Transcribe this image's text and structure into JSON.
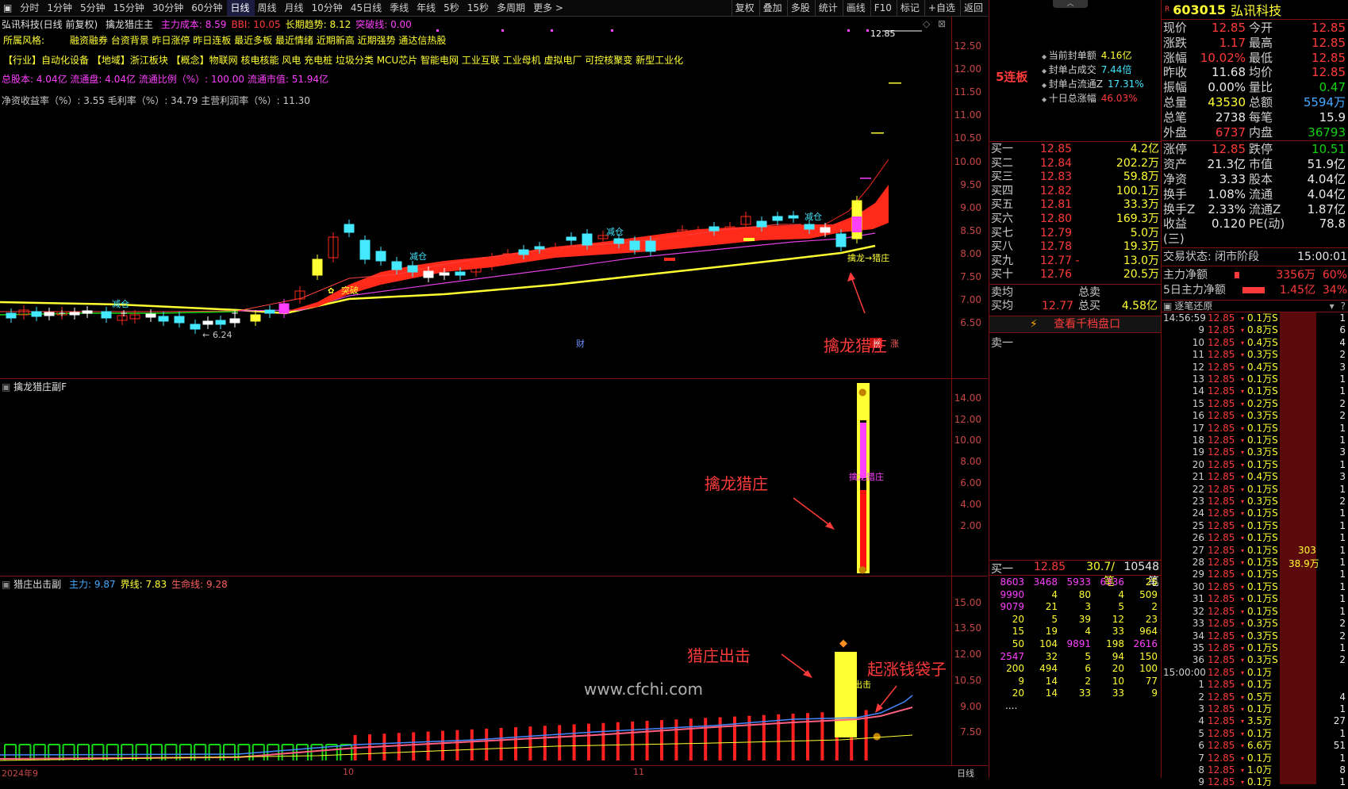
{
  "toolbar": {
    "periods": [
      "分时",
      "1分钟",
      "5分钟",
      "15分钟",
      "30分钟",
      "60分钟",
      "日线",
      "周线",
      "月线",
      "10分钟",
      "45日线",
      "季线",
      "年线",
      "5秒",
      "15秒",
      "多周期",
      "更多 >"
    ],
    "active": "日线",
    "right": [
      "复权",
      "叠加",
      "多股",
      "统计",
      "画线",
      "F10",
      "标记",
      "+自选",
      "返回"
    ]
  },
  "main_chart": {
    "title": "弘讯科技(日线 前复权)",
    "indicator": "擒龙猎庄主",
    "line1": [
      {
        "t": "主力成本: 8.59",
        "c": "#ff40ff"
      },
      {
        "t": "BBI: 10.05",
        "c": "#ff3a3a"
      },
      {
        "t": "长期趋势: 8.12",
        "c": "#ffff33"
      },
      {
        "t": "突破线: 0.00",
        "c": "#ff40ff"
      }
    ],
    "style_label": "所属风格:",
    "styles": "融资融券 台资背景 昨日涨停 昨日连板 最近多板 最近情绪 近期新高 近期强势 通达信热股",
    "concepts": "【行业】自动化设备 【地域】浙江板块 【概念】物联网 核电核能 风电 充电桩 垃圾分类 MCU芯片 智能电网 工业互联 工业母机 虚拟电厂 可控核聚变 新型工业化",
    "capital": "总股本: 4.04亿 流通盘: 4.04亿 流通比例（%）: 100.00 流通市值: 51.94亿",
    "ratios": "净资收益率（%）: 3.55 毛利率（%）: 34.79 主营利润率（%）: 11.30",
    "yaxis": [
      "12.50",
      "12.00",
      "11.50",
      "11.00",
      "10.50",
      "10.00",
      "9.50",
      "9.00",
      "8.50",
      "8.00",
      "7.50",
      "7.00",
      "6.50"
    ],
    "price_tag": "12.85",
    "low_tag": "6.24",
    "labels": {
      "reduce": "减仓",
      "breakout": "突破",
      "qinlong": "擒龙",
      "liezhuang": "猎庄",
      "cai": "财",
      "bang": "榜",
      "zhang": "涨"
    },
    "annotation": "擒龙猎庄"
  },
  "sub1": {
    "title": "擒龙猎庄副F",
    "yaxis": [
      "14.00",
      "12.00",
      "10.00",
      "8.00",
      "6.00",
      "4.00",
      "2.00"
    ],
    "annotation": "擒龙猎庄",
    "bar_label": "擒龙猎庄"
  },
  "sub2": {
    "title": "猎庄出击副",
    "values": [
      {
        "t": "主力: 9.87",
        "c": "#44aaff"
      },
      {
        "t": "界线: 7.83",
        "c": "#ffff33"
      },
      {
        "t": "生命线: 9.28",
        "c": "#ff6060"
      }
    ],
    "yaxis": [
      "15.00",
      "13.50",
      "12.00",
      "10.50",
      "9.00",
      "7.50"
    ],
    "annotation1": "猎庄出击",
    "annotation2": "起涨钱袋子",
    "bar_label": "猎庄出击",
    "watermark": "www.cfchi.com"
  },
  "xaxis": {
    "labels": [
      "2024年9",
      "10",
      "11"
    ],
    "right": "日线"
  },
  "middle": {
    "lianban": "5连板",
    "stats": [
      {
        "k": "当前封单额",
        "v": "4.16亿",
        "c": "#ffff33"
      },
      {
        "k": "封单占成交",
        "v": "7.44倍",
        "c": "#44e8ff"
      },
      {
        "k": "封单占流通Z",
        "v": "17.31%",
        "c": "#44e8ff"
      },
      {
        "k": "十日总涨幅",
        "v": "46.03%",
        "c": "#ff3a3a"
      }
    ],
    "buys": [
      [
        "买一",
        "12.85",
        "4.2亿"
      ],
      [
        "买二",
        "12.84",
        "202.2万"
      ],
      [
        "买三",
        "12.83",
        "59.8万"
      ],
      [
        "买四",
        "12.82",
        "100.1万"
      ],
      [
        "买五",
        "12.81",
        "33.3万"
      ],
      [
        "买六",
        "12.80",
        "169.3万"
      ],
      [
        "买七",
        "12.79",
        "5.0万"
      ],
      [
        "买八",
        "12.78",
        "19.3万"
      ],
      [
        "买九",
        "12.77 -",
        "13.0万"
      ],
      [
        "买十",
        "12.76",
        "20.5万"
      ]
    ],
    "sell_avg": "卖均",
    "sell_total": "总卖",
    "buy_avg": "买均",
    "buy_avg_val": "12.77",
    "buy_total": "总买",
    "buy_total_val": "4.58亿",
    "view_qian": "查看千档盘口",
    "sell1": "卖一",
    "queue_head": [
      "买一",
      "12.85",
      "30.7/笔",
      "10548笔"
    ],
    "queue": [
      [
        "8603",
        "3468",
        "5933",
        "6336",
        "25"
      ],
      [
        "9990",
        "4",
        "80",
        "4",
        "509"
      ],
      [
        "9079",
        "21",
        "3",
        "5",
        "2"
      ],
      [
        "20",
        "5",
        "39",
        "12",
        "23"
      ],
      [
        "15",
        "19",
        "4",
        "33",
        "964"
      ],
      [
        "50",
        "104",
        "9891",
        "198",
        "2616"
      ],
      [
        "2547",
        "32",
        "5",
        "94",
        "150"
      ],
      [
        "200",
        "494",
        "6",
        "20",
        "100"
      ],
      [
        "9",
        "14",
        "2",
        "10",
        "77"
      ],
      [
        "20",
        "14",
        "33",
        "33",
        "9"
      ]
    ],
    "queue_more": "...."
  },
  "quote": {
    "code": "603015",
    "name": "弘讯科技",
    "rows": [
      [
        "现价",
        "12.85",
        "今开",
        "12.85"
      ],
      [
        "涨跌",
        "1.17",
        "最高",
        "12.85"
      ],
      [
        "涨幅",
        "10.02%",
        "最低",
        "12.85"
      ],
      [
        "昨收",
        "11.68",
        "均价",
        "12.85"
      ],
      [
        "振幅",
        "0.00%",
        "量比",
        "0.47"
      ],
      [
        "总量",
        "43530",
        "总额",
        "5594万"
      ],
      [
        "总笔",
        "2738",
        "每笔",
        "15.9"
      ],
      [
        "外盘",
        "6737",
        "内盘",
        "36793"
      ]
    ],
    "rows2": [
      [
        "涨停",
        "12.85",
        "跌停",
        "10.51"
      ],
      [
        "资产",
        "21.3亿",
        "市值",
        "51.9亿"
      ],
      [
        "净资",
        "3.33",
        "股本",
        "4.04亿"
      ],
      [
        "换手",
        "1.08%",
        "流通",
        "4.04亿"
      ],
      [
        "换手Z",
        "2.33%",
        "流通Z",
        "1.87亿"
      ],
      [
        "收益(三)",
        "0.120",
        "PE(动)",
        "78.8"
      ]
    ],
    "trade_state": "交易状态: 闭市阶段",
    "trade_time": "15:00:01",
    "main_net_label": "主力净额",
    "main_net_val": "3356万",
    "main_net_pct": "60%",
    "five_net_label": "5日主力净额",
    "five_net_val": "1.45亿",
    "five_net_pct": "34%",
    "tick_title": "逐笔还原",
    "ticks": [
      [
        "14:56:59",
        "12.85",
        "0.1万S",
        "1"
      ],
      [
        "9",
        "12.85",
        "0.8万S",
        "6"
      ],
      [
        "10",
        "12.85",
        "0.4万S",
        "4"
      ],
      [
        "11",
        "12.85",
        "0.3万S",
        "2"
      ],
      [
        "12",
        "12.85",
        "0.4万S",
        "3"
      ],
      [
        "13",
        "12.85",
        "0.1万S",
        "1"
      ],
      [
        "14",
        "12.85",
        "0.1万S",
        "1"
      ],
      [
        "15",
        "12.85",
        "0.2万S",
        "2"
      ],
      [
        "16",
        "12.85",
        "0.3万S",
        "2"
      ],
      [
        "17",
        "12.85",
        "0.1万S",
        "1"
      ],
      [
        "18",
        "12.85",
        "0.1万S",
        "1"
      ],
      [
        "19",
        "12.85",
        "0.3万S",
        "3"
      ],
      [
        "20",
        "12.85",
        "0.1万S",
        "1"
      ],
      [
        "21",
        "12.85",
        "0.4万S",
        "3"
      ],
      [
        "22",
        "12.85",
        "0.1万S",
        "1"
      ],
      [
        "23",
        "12.85",
        "0.3万S",
        "2"
      ],
      [
        "24",
        "12.85",
        "0.1万S",
        "1"
      ],
      [
        "25",
        "12.85",
        "0.1万S",
        "1"
      ],
      [
        "26",
        "12.85",
        "0.1万S",
        "1"
      ],
      [
        "27",
        "12.85",
        "0.1万S",
        "1"
      ],
      [
        "28",
        "12.85",
        "0.1万S",
        "1"
      ],
      [
        "29",
        "12.85",
        "0.1万S",
        "1"
      ],
      [
        "30",
        "12.85",
        "0.1万S",
        "1"
      ],
      [
        "31",
        "12.85",
        "0.1万S",
        "1"
      ],
      [
        "32",
        "12.85",
        "0.1万S",
        "1"
      ],
      [
        "33",
        "12.85",
        "0.3万S",
        "2"
      ],
      [
        "34",
        "12.85",
        "0.3万S",
        "2"
      ],
      [
        "35",
        "12.85",
        "0.1万S",
        "1"
      ],
      [
        "36",
        "12.85",
        "0.3万S",
        "2"
      ],
      [
        "15:00:00",
        "12.85",
        "0.1万",
        ""
      ],
      [
        "1",
        "12.85",
        "0.1万",
        ""
      ],
      [
        "2",
        "12.85",
        "0.5万",
        "4"
      ],
      [
        "3",
        "12.85",
        "0.1万",
        "1"
      ],
      [
        "4",
        "12.85",
        "3.5万",
        "27"
      ],
      [
        "5",
        "12.85",
        "0.1万",
        "1"
      ],
      [
        "6",
        "12.85",
        "6.6万",
        "51"
      ],
      [
        "7",
        "12.85",
        "0.1万",
        "1"
      ],
      [
        "8",
        "12.85",
        "1.0万",
        "8"
      ],
      [
        "9",
        "12.85",
        "0.1万",
        "1"
      ]
    ],
    "big_vol": "303",
    "big_amt": "38.9万"
  }
}
